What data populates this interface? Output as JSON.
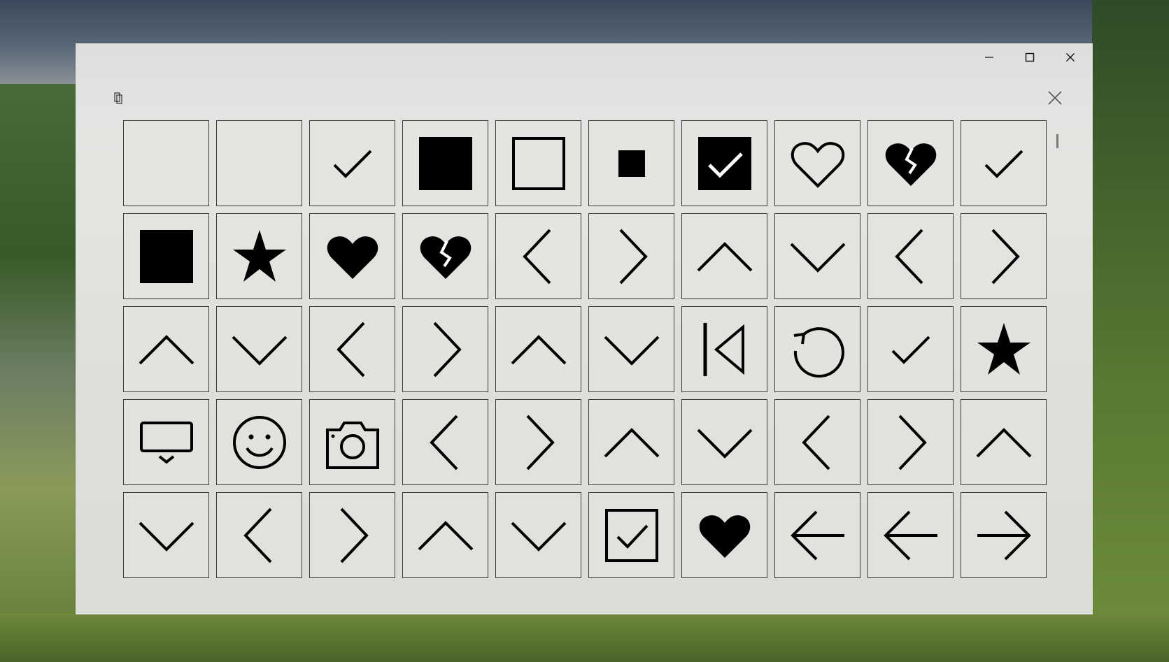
{
  "window": {
    "controls": [
      {
        "name": "minimize-button",
        "icon": "minimize-icon"
      },
      {
        "name": "maximize-button",
        "icon": "maximize-icon"
      },
      {
        "name": "close-window-button",
        "icon": "close-icon"
      }
    ],
    "toolbar": {
      "copy_icon": "copy-icon",
      "dismiss_icon": "dismiss-icon"
    }
  },
  "glyphs": [
    [
      "blank",
      "blank",
      "checkmark",
      "square-filled",
      "square-outline",
      "small-square-filled",
      "checkbox-checked-filled",
      "heart-outline",
      "heart-broken-filled",
      "checkmark"
    ],
    [
      "square-filled",
      "star-filled",
      "heart-filled",
      "heart-broken-filled",
      "chevron-left",
      "chevron-right",
      "chevron-up",
      "chevron-down",
      "chevron-left",
      "chevron-right"
    ],
    [
      "chevron-up",
      "chevron-down",
      "chevron-left",
      "chevron-right",
      "chevron-up",
      "chevron-down",
      "skip-back",
      "refresh",
      "checkmark",
      "star-filled"
    ],
    [
      "cast-screen",
      "smiley",
      "camera",
      "chevron-left",
      "chevron-right",
      "chevron-up",
      "chevron-down",
      "chevron-left",
      "chevron-right",
      "chevron-up"
    ],
    [
      "chevron-down",
      "chevron-left",
      "chevron-right",
      "chevron-up",
      "chevron-down",
      "checkbox-checked-outline",
      "heart-filled",
      "arrow-left",
      "arrow-left",
      "arrow-right"
    ]
  ]
}
